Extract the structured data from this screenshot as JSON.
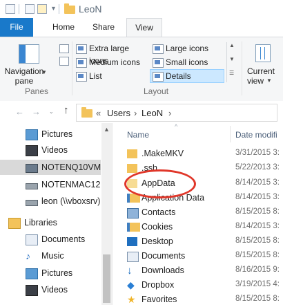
{
  "window": {
    "title": "LeoN"
  },
  "ribbon": {
    "tabs": [
      "File",
      "Home",
      "Share",
      "View"
    ],
    "panes_group": {
      "navigation_pane_label": "Navigation pane",
      "group_label": "Panes"
    },
    "layout_group": {
      "items": [
        "Extra large icons",
        "Large icons",
        "Medium icons",
        "Small icons",
        "List",
        "Details"
      ],
      "group_label": "Layout"
    },
    "current_view_label": "Current view"
  },
  "address": {
    "crumbs": [
      "«",
      "Users",
      "LeoN"
    ]
  },
  "nav_pane": {
    "items": [
      {
        "label": "Pictures",
        "icon": "pictures-icon"
      },
      {
        "label": "Videos",
        "icon": "videos-icon"
      },
      {
        "label": "NOTENQ10VM (",
        "icon": "computer-icon"
      },
      {
        "label": "NOTENMAC12E",
        "icon": "network-drive-icon"
      },
      {
        "label": "leon (\\\\vboxsrv)",
        "icon": "network-drive-icon"
      },
      {
        "label": "Libraries",
        "icon": "libraries-icon"
      },
      {
        "label": "Documents",
        "icon": "documents-icon"
      },
      {
        "label": "Music",
        "icon": "music-icon"
      },
      {
        "label": "Pictures",
        "icon": "pictures-icon"
      },
      {
        "label": "Videos",
        "icon": "videos-icon"
      }
    ]
  },
  "file_list": {
    "columns": {
      "name": "Name",
      "date": "Date modifi"
    },
    "rows": [
      {
        "name": ".MakeMKV",
        "date": "3/31/2015 3:",
        "icon": "folder-icon"
      },
      {
        "name": ".ssh",
        "date": "5/22/2013 3:",
        "icon": "folder-icon"
      },
      {
        "name": "AppData",
        "date": "8/14/2015 3:",
        "icon": "folder-icon"
      },
      {
        "name": "Application Data",
        "date": "8/14/2015 3:",
        "icon": "shortcut-folder-icon"
      },
      {
        "name": "Contacts",
        "date": "8/15/2015 8:",
        "icon": "contacts-icon"
      },
      {
        "name": "Cookies",
        "date": "8/14/2015 3:",
        "icon": "shortcut-folder-icon"
      },
      {
        "name": "Desktop",
        "date": "8/15/2015 8:",
        "icon": "desktop-icon"
      },
      {
        "name": "Documents",
        "date": "8/15/2015 8:",
        "icon": "documents-icon"
      },
      {
        "name": "Downloads",
        "date": "8/16/2015 9:",
        "icon": "downloads-icon"
      },
      {
        "name": "Dropbox",
        "date": "3/19/2015 4:",
        "icon": "dropbox-icon"
      },
      {
        "name": "Favorites",
        "date": "8/15/2015 8:",
        "icon": "favorites-icon"
      }
    ]
  },
  "colors": {
    "file_tab": "#1979ca",
    "selection": "#cce8ff",
    "highlight": "#e0372a",
    "folder": "#f3c35a"
  }
}
